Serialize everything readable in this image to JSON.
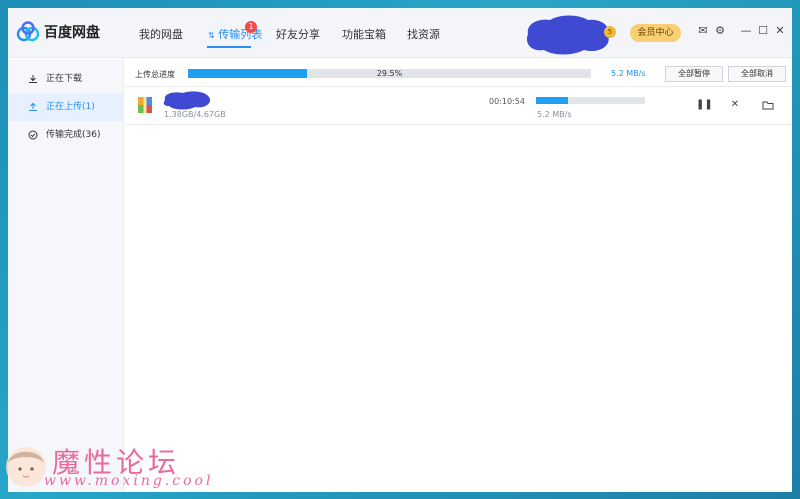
{
  "app": {
    "title": "百度网盘"
  },
  "nav": {
    "tabs": [
      {
        "label": "我的网盘"
      },
      {
        "label": "传输列表",
        "badge": "1"
      },
      {
        "label": "好友分享"
      },
      {
        "label": "功能宝箱"
      },
      {
        "label": "找资源"
      }
    ]
  },
  "header": {
    "level": "5",
    "vip_label": "会员中心"
  },
  "sidebar": {
    "items": [
      {
        "label": "正在下载",
        "icon": "download-icon"
      },
      {
        "label": "正在上传(1)",
        "icon": "upload-icon"
      },
      {
        "label": "传输完成(36)",
        "icon": "check-circle-icon"
      }
    ]
  },
  "upload_summary": {
    "label": "上传总进度",
    "progress_percent": 29.5,
    "progress_text": "29.5%",
    "speed": "5.2 MB/s",
    "pause_all_label": "全部暂停",
    "cancel_all_label": "全部取消"
  },
  "files": [
    {
      "size_text": "1.38GB/4.67GB",
      "time_left": "00:10:54",
      "progress_percent": 29.5,
      "speed": "5.2 MB/s",
      "icon": "archive-file-icon"
    }
  ],
  "watermark": {
    "title": "魔性论坛",
    "url": "www.moxing.cool"
  },
  "colors": {
    "accent": "#2a8df0",
    "progress": "#1e9ff2",
    "badge": "#f24b4b",
    "vip": "#f7cf74",
    "blob": "#3f49d1"
  }
}
